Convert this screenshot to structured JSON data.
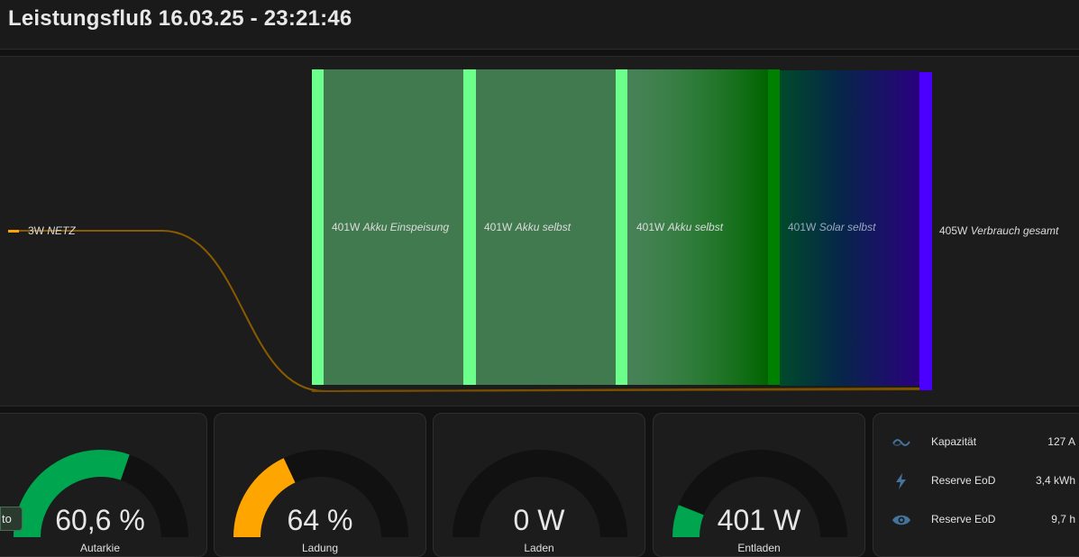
{
  "header": {
    "title": "Leistungsfluß 16.03.25 - 23:21:46"
  },
  "sankey": {
    "source": {
      "value": "3W",
      "name": "NETZ",
      "color": "#ffa500"
    },
    "columns": [
      {
        "value": "401W",
        "name": "Akku Einspeisung",
        "color": "#6cff8c"
      },
      {
        "value": "401W",
        "name": "Akku selbst",
        "color": "#6cff8c"
      },
      {
        "value": "401W",
        "name": "Akku selbst",
        "color": "#6cff8c"
      },
      {
        "value": "401W",
        "name": "Solar selbst",
        "color": "#008000"
      }
    ],
    "sink": {
      "value": "405W",
      "name": "Verbrauch gesamt",
      "color": "#4b00ff"
    }
  },
  "gauges": [
    {
      "value": "60,6 %",
      "label": "Autarkie",
      "fraction": 0.606,
      "color": "#00a54f"
    },
    {
      "value": "64 %",
      "label": "Ladung",
      "fraction": 0.36,
      "color": "#ffa500"
    },
    {
      "value": "0 W",
      "label": "Laden",
      "fraction": 0,
      "color": "#00a54f"
    },
    {
      "value": "401 W",
      "label": "Entladen",
      "fraction": 0.12,
      "color": "#00a54f"
    }
  ],
  "tooltip": {
    "text": "to"
  },
  "entities": [
    {
      "icon": "wave-icon",
      "name": "Kapazität",
      "value": "127 A"
    },
    {
      "icon": "lightning-icon",
      "name": "Reserve EoD",
      "value": "3,4 kWh"
    },
    {
      "icon": "eye-icon",
      "name": "Reserve EoD",
      "value": "9,7 h"
    }
  ],
  "colors": {
    "track": "#111111",
    "icon": "#44739e"
  }
}
